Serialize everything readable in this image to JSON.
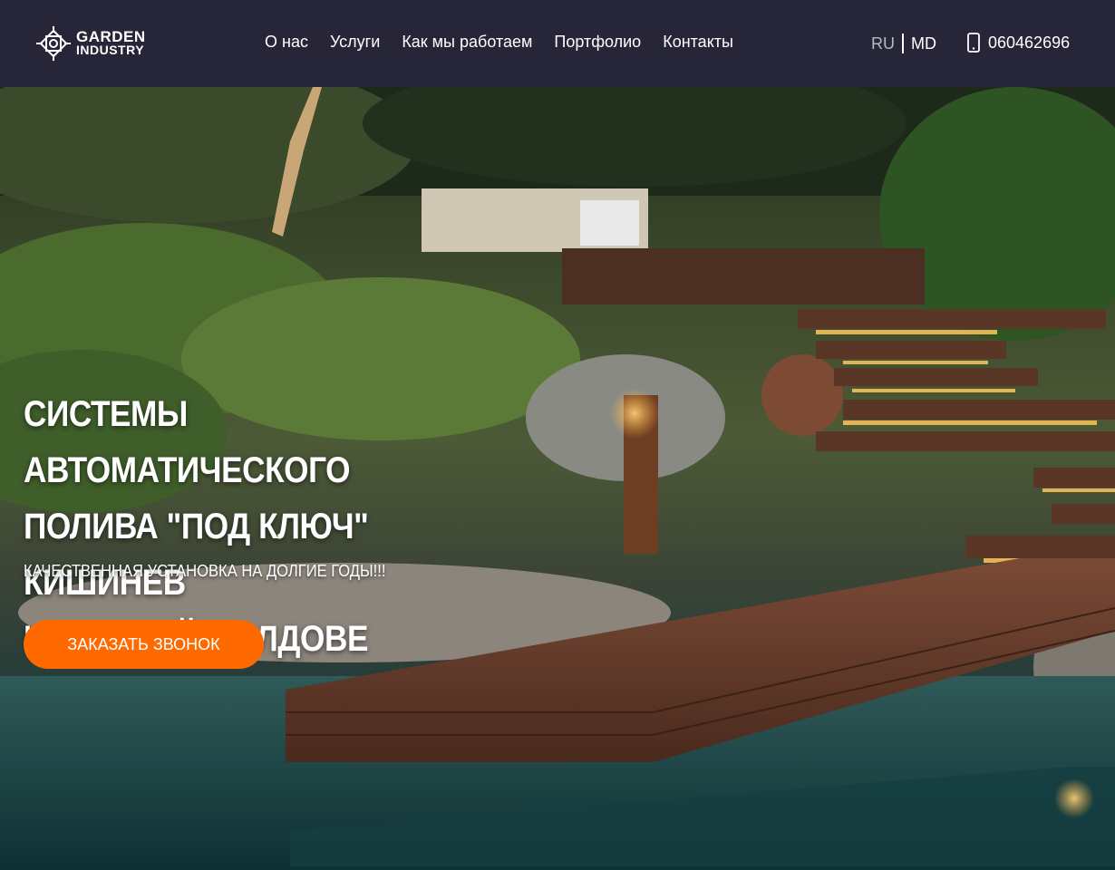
{
  "header": {
    "logo_line1": "GARDEN",
    "logo_line2": "INDUSTRY",
    "nav": [
      "О нас",
      "Услуги",
      "Как мы работаем",
      "Портфолио",
      "Контакты"
    ],
    "lang_ru": "RU",
    "lang_md": "MD",
    "phone": "060462696",
    "phone_icon": "mobile-phone-icon"
  },
  "hero": {
    "title_line1": "СИСТЕМЫ АВТОМАТИЧЕСКОГО",
    "title_line2": "ПОЛИВА \"ПОД КЛЮЧ\" КИШИНЕВ",
    "title_line3": "И ПО ВСЕЙ МОЛДОВЕ",
    "subtitle": "КАЧЕСТВЕННАЯ УСТАНОВКА НА ДОЛГИЕ ГОДЫ!!!",
    "cta_label": "ЗАКАЗАТЬ ЗВОНОК",
    "background": "garden-landscape-photo"
  },
  "colors": {
    "header_bg": "#272638",
    "accent": "#ff6a00",
    "text": "#ffffff"
  }
}
